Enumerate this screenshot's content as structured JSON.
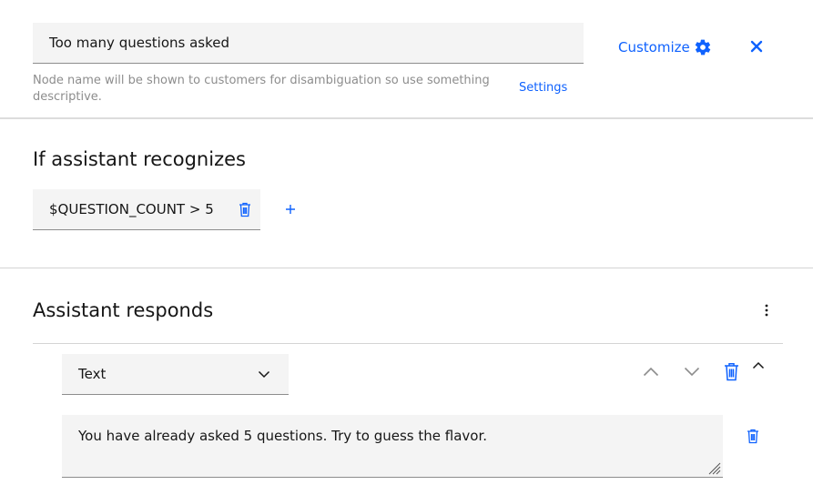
{
  "node": {
    "name_value": "Too many questions asked",
    "helper_text": "Node name will be shown to customers for disambiguation so use something descriptive.",
    "settings_link": "Settings",
    "customize_label": "Customize"
  },
  "condition_section": {
    "title": "If assistant recognizes",
    "condition": "$QUESTION_COUNT > 5"
  },
  "response_section": {
    "title": "Assistant responds",
    "response_type": "Text",
    "response_text": "You have already asked 5 questions.  Try to guess the flavor."
  },
  "icons": {
    "customize": "gear-icon",
    "close": "close-icon",
    "delete": "trash-icon",
    "add": "plus-icon",
    "overflow": "overflow-menu-vertical-icon",
    "move_up": "chevron-up-icon",
    "move_down": "chevron-down-icon",
    "collapse": "chevron-up-icon",
    "resize": "resize-grip-icon"
  },
  "colors": {
    "accent": "#0f62fe",
    "field_background": "#f4f4f4",
    "helper_text": "#8d8d8d",
    "icon_gray": "#8d8d8d"
  }
}
